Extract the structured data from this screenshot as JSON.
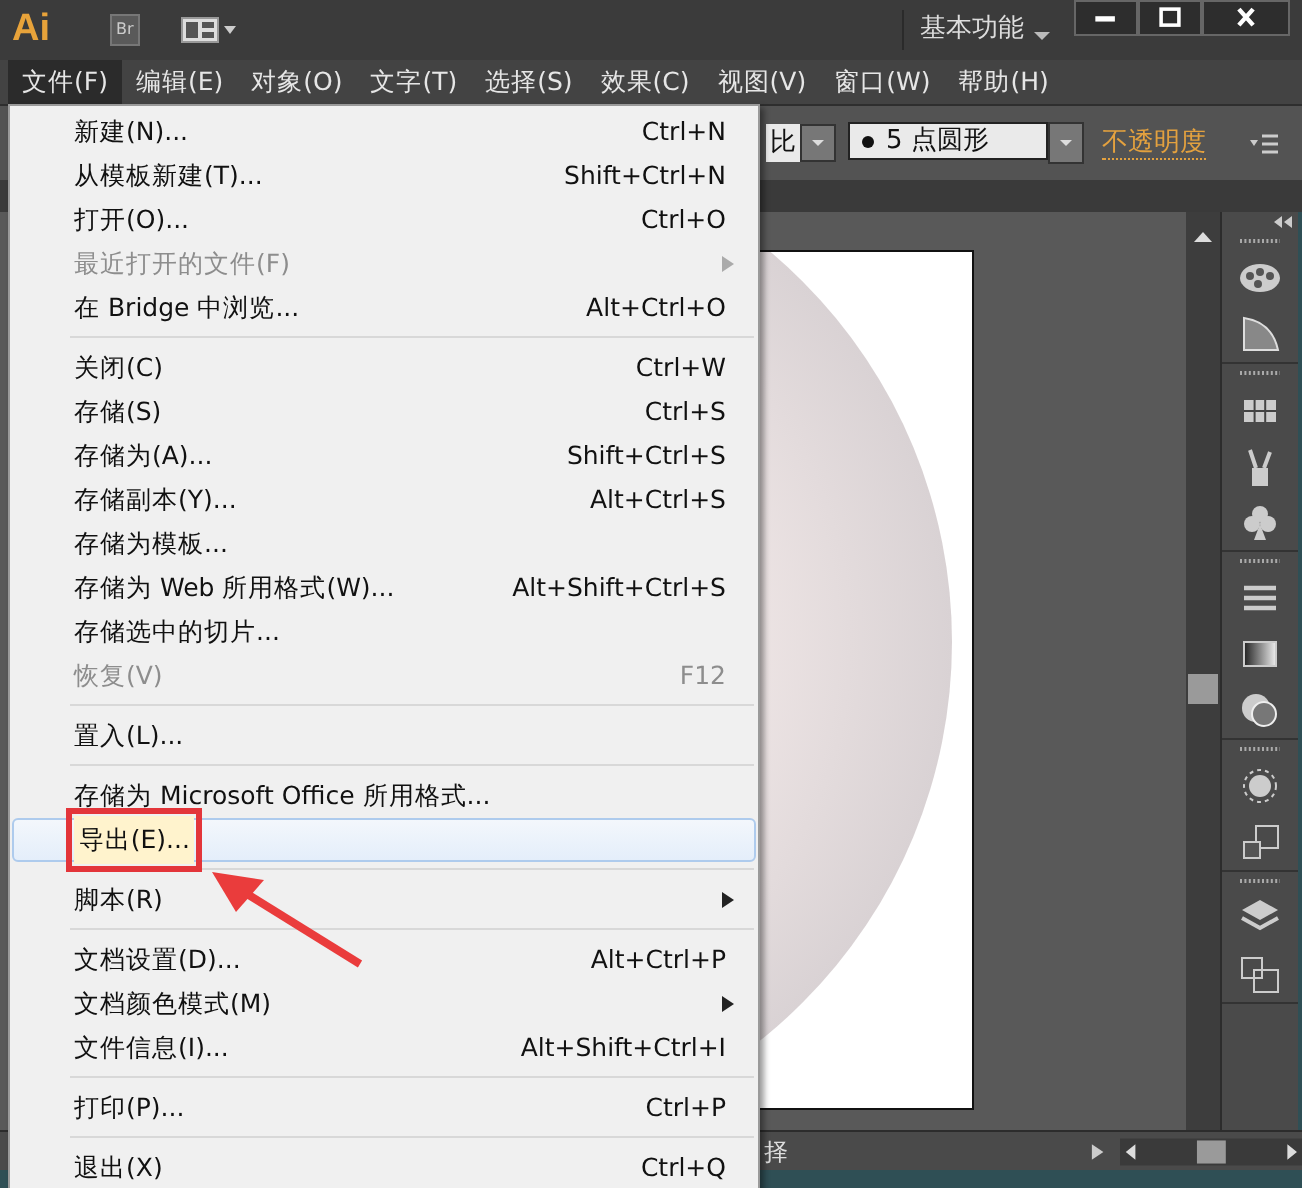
{
  "title_bar": {
    "logo": "Ai",
    "bridge_button": "Br",
    "workspace": "基本功能"
  },
  "menu_bar": [
    {
      "label": "文件(F)",
      "selected": true
    },
    {
      "label": "编辑(E)",
      "selected": false
    },
    {
      "label": "对象(O)",
      "selected": false
    },
    {
      "label": "文字(T)",
      "selected": false
    },
    {
      "label": "选择(S)",
      "selected": false
    },
    {
      "label": "效果(C)",
      "selected": false
    },
    {
      "label": "视图(V)",
      "selected": false
    },
    {
      "label": "窗口(W)",
      "selected": false
    },
    {
      "label": "帮助(H)",
      "selected": false
    }
  ],
  "control_bar": {
    "ratio_label": "比",
    "brush_value": "5 点圆形",
    "opacity_link": "不透明度"
  },
  "file_menu": [
    {
      "kind": "item",
      "label": "新建(N)...",
      "shortcut": "Ctrl+N",
      "disabled": false,
      "submenu": false,
      "selected": false
    },
    {
      "kind": "item",
      "label": "从模板新建(T)...",
      "shortcut": "Shift+Ctrl+N",
      "disabled": false,
      "submenu": false,
      "selected": false
    },
    {
      "kind": "item",
      "label": "打开(O)...",
      "shortcut": "Ctrl+O",
      "disabled": false,
      "submenu": false,
      "selected": false
    },
    {
      "kind": "item",
      "label": "最近打开的文件(F)",
      "disabled": true,
      "submenu": true,
      "selected": false
    },
    {
      "kind": "item",
      "label": "在 Bridge 中浏览...",
      "shortcut": "Alt+Ctrl+O",
      "disabled": false,
      "submenu": false,
      "selected": false
    },
    {
      "kind": "separator"
    },
    {
      "kind": "item",
      "label": "关闭(C)",
      "shortcut": "Ctrl+W",
      "disabled": false,
      "submenu": false,
      "selected": false
    },
    {
      "kind": "item",
      "label": "存储(S)",
      "shortcut": "Ctrl+S",
      "disabled": false,
      "submenu": false,
      "selected": false
    },
    {
      "kind": "item",
      "label": "存储为(A)...",
      "shortcut": "Shift+Ctrl+S",
      "disabled": false,
      "submenu": false,
      "selected": false
    },
    {
      "kind": "item",
      "label": "存储副本(Y)...",
      "shortcut": "Alt+Ctrl+S",
      "disabled": false,
      "submenu": false,
      "selected": false
    },
    {
      "kind": "item",
      "label": "存储为模板...",
      "disabled": false,
      "submenu": false,
      "selected": false
    },
    {
      "kind": "item",
      "label": "存储为 Web 所用格式(W)...",
      "shortcut": "Alt+Shift+Ctrl+S",
      "disabled": false,
      "submenu": false,
      "selected": false
    },
    {
      "kind": "item",
      "label": "存储选中的切片...",
      "disabled": false,
      "submenu": false,
      "selected": false
    },
    {
      "kind": "item",
      "label": "恢复(V)",
      "shortcut": "F12",
      "disabled": true,
      "submenu": false,
      "selected": false
    },
    {
      "kind": "separator"
    },
    {
      "kind": "item",
      "label": "置入(L)...",
      "disabled": false,
      "submenu": false,
      "selected": false
    },
    {
      "kind": "separator"
    },
    {
      "kind": "item",
      "label": "存储为 Microsoft Office 所用格式...",
      "disabled": false,
      "submenu": false,
      "selected": false
    },
    {
      "kind": "item",
      "label": "导出(E)...",
      "disabled": false,
      "submenu": false,
      "selected": true,
      "marked": true
    },
    {
      "kind": "separator"
    },
    {
      "kind": "item",
      "label": "脚本(R)",
      "disabled": false,
      "submenu": true,
      "selected": false
    },
    {
      "kind": "separator"
    },
    {
      "kind": "item",
      "label": "文档设置(D)...",
      "shortcut": "Alt+Ctrl+P",
      "disabled": false,
      "submenu": false,
      "selected": false
    },
    {
      "kind": "item",
      "label": "文档颜色模式(M)",
      "disabled": false,
      "submenu": true,
      "selected": false
    },
    {
      "kind": "item",
      "label": "文件信息(I)...",
      "shortcut": "Alt+Shift+Ctrl+I",
      "disabled": false,
      "submenu": false,
      "selected": false
    },
    {
      "kind": "separator"
    },
    {
      "kind": "item",
      "label": "打印(P)...",
      "shortcut": "Ctrl+P",
      "disabled": false,
      "submenu": false,
      "selected": false
    },
    {
      "kind": "separator"
    },
    {
      "kind": "item",
      "label": "退出(X)",
      "shortcut": "Ctrl+Q",
      "disabled": false,
      "submenu": false,
      "selected": false
    }
  ],
  "status_bar": {
    "text": "择"
  }
}
